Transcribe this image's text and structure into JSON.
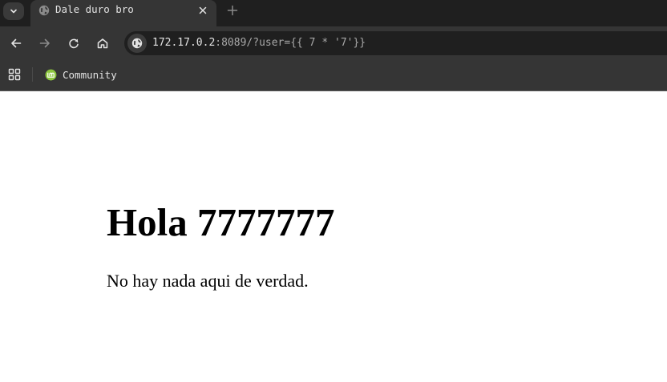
{
  "window": {
    "tab": {
      "title": "Dale duro bro",
      "favicon": "globe-icon"
    }
  },
  "toolbar": {
    "url": {
      "host": "172.17.0.2",
      "rest": ":8089/?user={{ 7 * '7'}}"
    }
  },
  "bookmarks": {
    "items": [
      {
        "label": "Community",
        "icon": "linux-mint-icon"
      }
    ]
  },
  "page": {
    "heading": "Hola 7777777",
    "text": "No hay nada aqui de verdad."
  },
  "colors": {
    "tabstrip": "#1f1f1f",
    "toolbar": "#353535",
    "omnibox": "#1f1f1f",
    "mint_green": "#8dc73f"
  }
}
